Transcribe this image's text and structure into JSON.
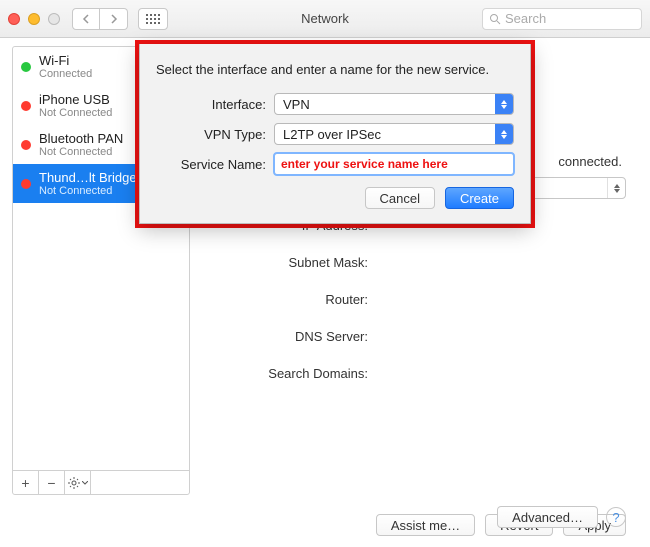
{
  "window": {
    "title": "Network",
    "search_placeholder": "Search"
  },
  "sidebar": {
    "items": [
      {
        "name": "Wi-Fi",
        "status": "Connected",
        "color": "green"
      },
      {
        "name": "iPhone USB",
        "status": "Not Connected",
        "color": "red"
      },
      {
        "name": "Bluetooth PAN",
        "status": "Not Connected",
        "color": "red"
      },
      {
        "name": "Thund…lt Bridge",
        "status": "Not Connected",
        "color": "red",
        "selected": true
      }
    ]
  },
  "main": {
    "status_suffix": "connected.",
    "config_select_value": "",
    "labels": {
      "ip": "IP Address:",
      "subnet": "Subnet Mask:",
      "router": "Router:",
      "dns": "DNS Server:",
      "search": "Search Domains:"
    },
    "advanced": "Advanced…"
  },
  "sheet": {
    "prompt": "Select the interface and enter a name for the new service.",
    "labels": {
      "interface": "Interface:",
      "vpntype": "VPN Type:",
      "service": "Service Name:"
    },
    "interface_value": "VPN",
    "vpntype_value": "L2TP over IPSec",
    "service_value": "enter your service name here",
    "cancel": "Cancel",
    "create": "Create"
  },
  "footer": {
    "assist": "Assist me…",
    "revert": "Revert",
    "apply": "Apply"
  }
}
